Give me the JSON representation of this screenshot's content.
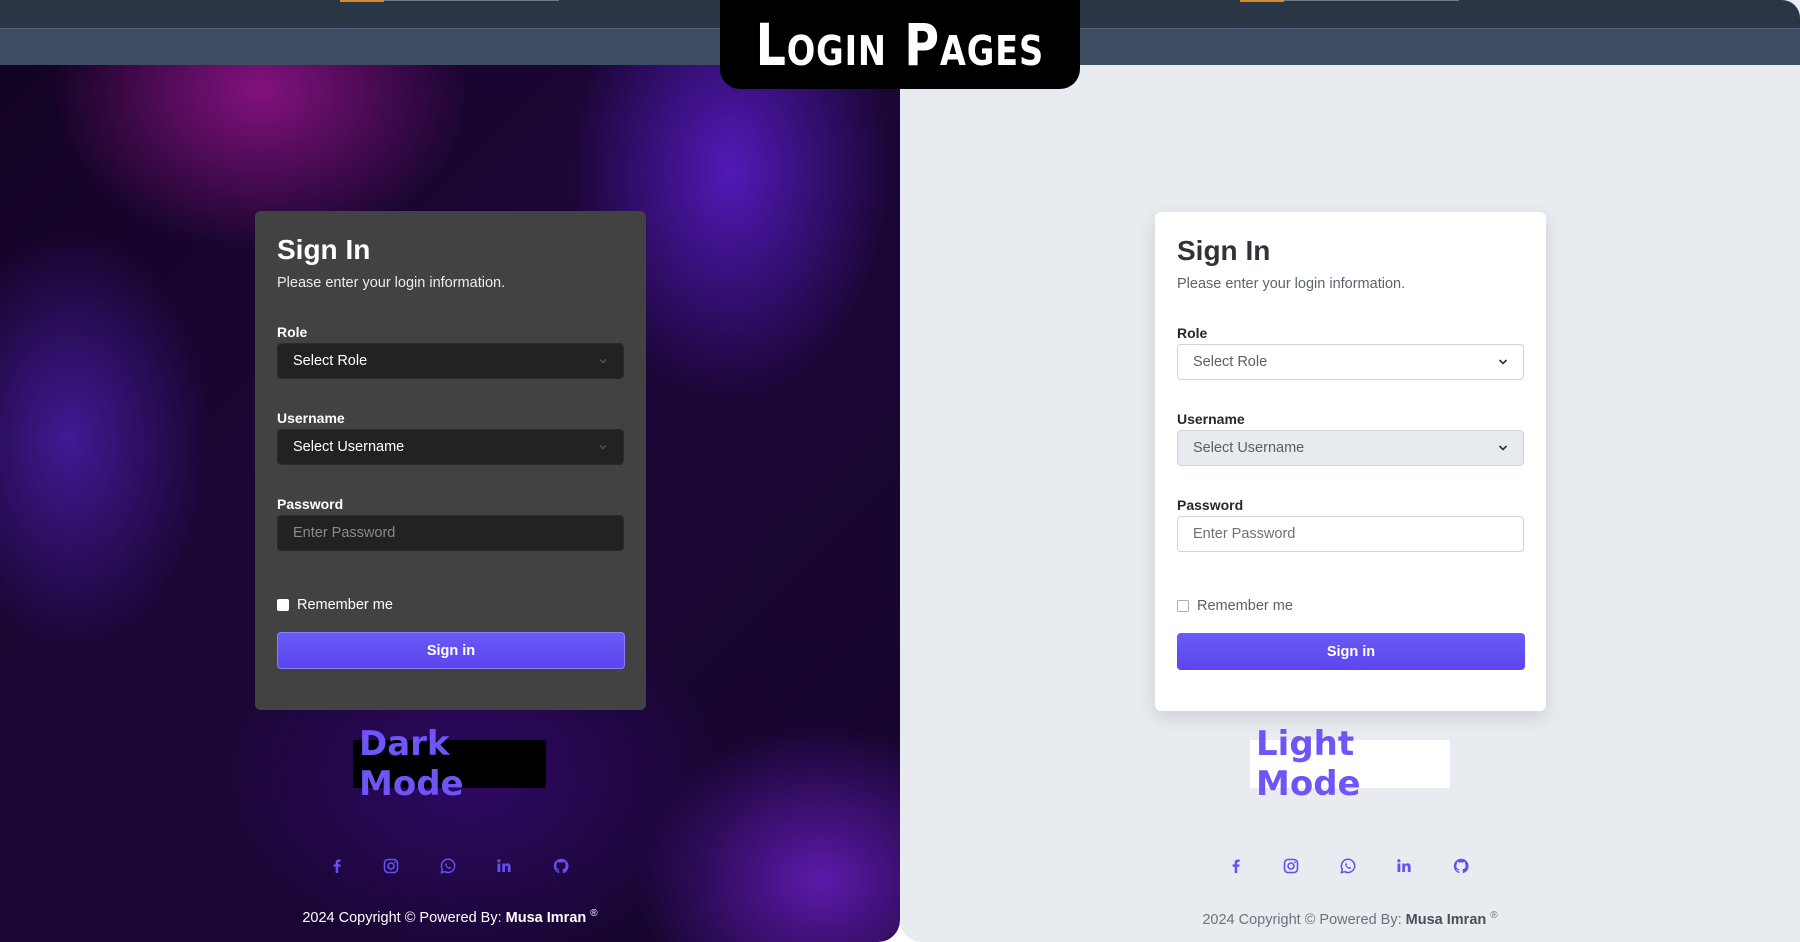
{
  "banner": {
    "title": "Login Pages"
  },
  "dark": {
    "heading": "Sign In",
    "subtitle": "Please enter your login information.",
    "role_label": "Role",
    "role_value": "Select Role",
    "username_label": "Username",
    "username_value": "Select Username",
    "password_label": "Password",
    "password_placeholder": "Enter Password",
    "remember_label": "Remember me",
    "signin_button": "Sign in",
    "mode_label": "Dark Mode",
    "copyright_prefix": "2024 Copyright © Powered By: ",
    "copyright_author": "Musa Imran",
    "copyright_mark": "®"
  },
  "light": {
    "heading": "Sign In",
    "subtitle": "Please enter your login information.",
    "role_label": "Role",
    "role_value": "Select Role",
    "username_label": "Username",
    "username_value": "Select Username",
    "password_label": "Password",
    "password_placeholder": "Enter Password",
    "remember_label": "Remember me",
    "signin_button": "Sign in",
    "mode_label": "Light Mode",
    "copyright_prefix": "2024 Copyright © Powered By: ",
    "copyright_author": "Musa Imran",
    "copyright_mark": "®"
  },
  "social_icons": [
    "facebook-icon",
    "instagram-icon",
    "whatsapp-icon",
    "linkedin-icon",
    "github-icon"
  ],
  "colors": {
    "accent": "#6e55f7",
    "button": "#5b46ee",
    "dark_card": "#424242",
    "light_bg": "#e8ebef",
    "social_icon": "#6350f0"
  }
}
